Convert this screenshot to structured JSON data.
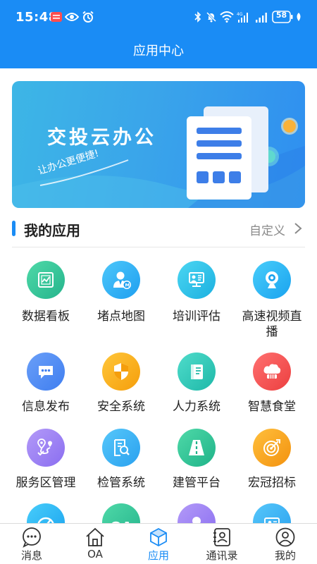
{
  "status_bar": {
    "time": "15:48",
    "battery": "58"
  },
  "header": {
    "title": "应用中心"
  },
  "banner": {
    "title": "交投云办公",
    "subtitle": "让办公更便捷!"
  },
  "section": {
    "title": "我的应用",
    "action_label": "自定义"
  },
  "apps": [
    {
      "label": "数据看板",
      "icon": "chart-board-icon",
      "color": "#2fc29a"
    },
    {
      "label": "堵点地图",
      "icon": "person-badge-icon",
      "color": "#2db6f5"
    },
    {
      "label": "培训评估",
      "icon": "presentation-icon",
      "color": "#25c1e8"
    },
    {
      "label": "高速视频直播",
      "label_line1": "高速视频直",
      "label_line2": "播",
      "icon": "webcam-icon",
      "color": "#22b8f0"
    },
    {
      "label": "信息发布",
      "icon": "chat-bubble-icon",
      "color": "#4a8ef2"
    },
    {
      "label": "安全系统",
      "icon": "shield-icon",
      "color": "#f7b21c"
    },
    {
      "label": "人力系统",
      "icon": "book-icon",
      "color": "#2dc6b8"
    },
    {
      "label": "智慧食堂",
      "icon": "chef-hat-icon",
      "color": "#f25050"
    },
    {
      "label": "服务区管理",
      "icon": "map-pin-route-icon",
      "color": "#9b7df0"
    },
    {
      "label": "检管系统",
      "icon": "document-search-icon",
      "color": "#3ab6f2"
    },
    {
      "label": "建管平台",
      "icon": "road-icon",
      "color": "#2fc29a"
    },
    {
      "label": "宏冠招标",
      "icon": "target-icon",
      "color": "#f7a21c"
    },
    {
      "label": "",
      "icon": "speedometer-icon",
      "color": "#22b8f0"
    },
    {
      "label": "",
      "icon": "oa-icon",
      "color": "#2fc29a"
    },
    {
      "label": "",
      "icon": "person-icon",
      "color": "#9b7df0"
    },
    {
      "label": "",
      "icon": "id-card-icon",
      "color": "#3ab6f2"
    }
  ],
  "apps_partial_text": {
    "oa_icon_text": "OA"
  },
  "nav": [
    {
      "label": "消息",
      "icon": "chat-icon",
      "active": false
    },
    {
      "label": "OA",
      "icon": "home-icon",
      "active": false
    },
    {
      "label": "应用",
      "icon": "cube-icon",
      "active": true
    },
    {
      "label": "通讯录",
      "icon": "contacts-icon",
      "active": false
    },
    {
      "label": "我的",
      "icon": "profile-icon",
      "active": false
    }
  ],
  "colors": {
    "primary": "#1a8cf5",
    "text": "#222222",
    "muted": "#8a8a8a"
  }
}
